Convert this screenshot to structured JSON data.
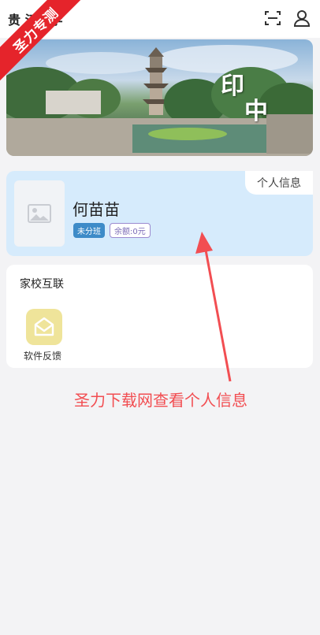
{
  "header": {
    "title": "贵      江中学",
    "scan_icon": "scan-icon",
    "user_icon": "user-icon"
  },
  "watermark": {
    "ribbon_text": "圣力专测"
  },
  "banner": {
    "overlay_text_top": "印",
    "overlay_text_bottom": "中"
  },
  "profile": {
    "tab_label": "个人信息",
    "name": "何苗苗",
    "class_badge": "未分班",
    "balance_badge": "余额:0元"
  },
  "home_school": {
    "title": "家校互联",
    "apps": [
      {
        "label": "软件反馈",
        "icon": "feedback-envelope-icon"
      }
    ]
  },
  "annotation": {
    "caption": "圣力下载网查看个人信息",
    "color": "#f24e52"
  }
}
